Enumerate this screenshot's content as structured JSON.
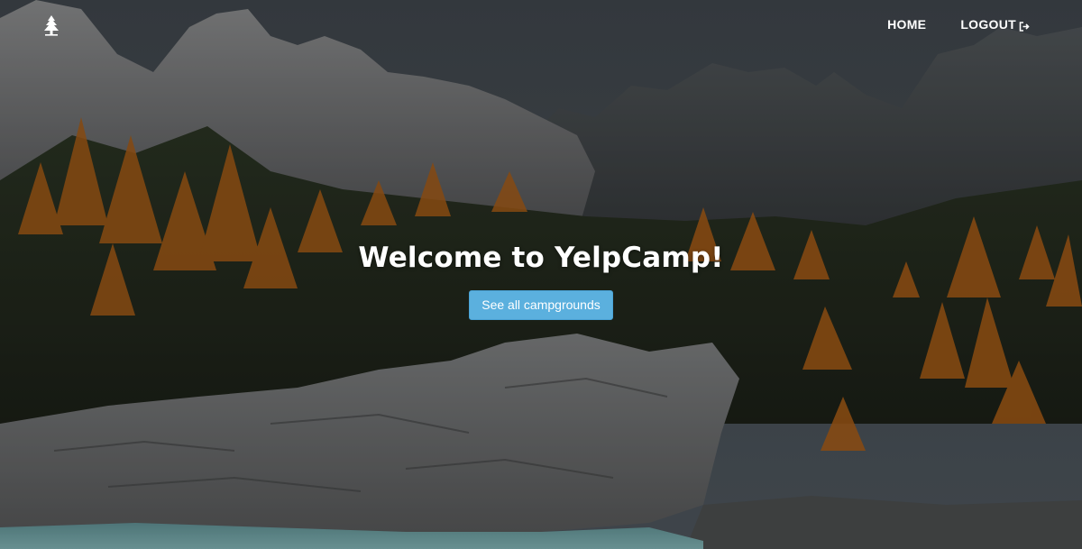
{
  "navbar": {
    "brand_icon": "tree-icon",
    "links": [
      {
        "label": "HOME"
      },
      {
        "label": "LOGOUT",
        "icon": "sign-out-icon"
      }
    ]
  },
  "hero": {
    "title": "Welcome to YelpCamp!",
    "button_label": "See all campgrounds",
    "button_color": "#5bb0de",
    "background": "mountain-autumn-landscape"
  }
}
